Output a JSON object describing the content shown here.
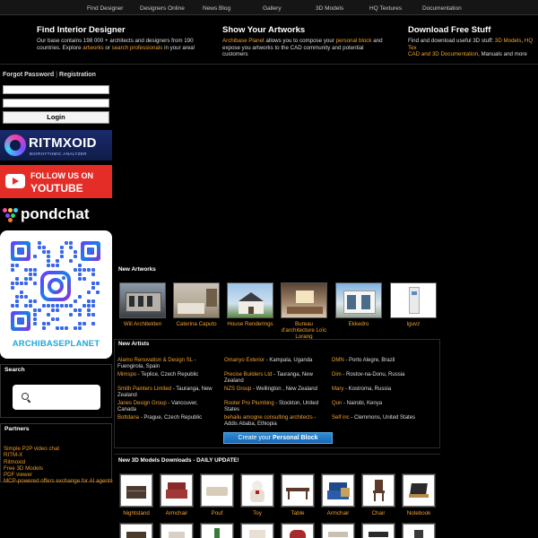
{
  "nav": [
    "Find Designer",
    "Designers Online",
    "News Blog",
    "Gallery",
    "3D Models",
    "HQ Textures",
    "Documentation"
  ],
  "promo": [
    {
      "title": "Find Interior Designer",
      "t1": "Our base contains 198 000 + architects and designers from 190 countries. Explore ",
      "l1": "artworks",
      "t2": " or ",
      "l2": "search professionals",
      "t3": " in your area!"
    },
    {
      "title": "Show Your Artworks",
      "l1": "Archibase Planet",
      "t1": " allows you to compose your ",
      "l2": "personal block",
      "t2": " and expose you artworks to the CAD community and potential customers"
    },
    {
      "title": "Download Free Stuff",
      "t1": "Find and download useful 3D stuff: ",
      "l1": "3D Models",
      "t2": ", ",
      "l2": "HQ Tex",
      "l3": "CAD and 3D Documentation",
      "t3": ", Manuals and more"
    }
  ],
  "auth": {
    "forgot": "Forgot Password",
    "sep": "|",
    "register": "Registration",
    "login": "Login"
  },
  "ads": {
    "ritm_title": "RITMXOID",
    "ritm_sub": "BIORHYTHMIC ANALYZER",
    "yt_line1": "FOLLOW US ON",
    "yt_line2": "YOUTUBE",
    "pond": "pondchat",
    "qr_brand": "ARCHIBASEPLANET"
  },
  "search": {
    "title": "Search",
    "placeholder": ""
  },
  "partners": {
    "title": "Partners",
    "items": [
      "Simple P2P video chat",
      "RITM-X",
      "Ritmoxid",
      "Free 3D Models",
      "PDF viewer",
      "MCP-powered offers exchange for AI agents"
    ]
  },
  "sections": {
    "artworks": "New Artworks",
    "artists": "New Artists",
    "models": "New 3D Models Downloads - DAILY UPDATE!"
  },
  "artworks": [
    "Wiil Architekten",
    "Caterina Caputo",
    "House Renderings",
    "Bureau d'architecture Loïc Lorang",
    "Ekkedro",
    "lguvz"
  ],
  "artists": [
    {
      "name": "Alamo Renovation & Design SL",
      "loc": " - Fuengirola, Spain"
    },
    {
      "name": "Omanyo Exterior",
      "loc": " - Kampala, Uganda"
    },
    {
      "name": "DMN",
      "loc": " - Porto Alegre, Brazil"
    },
    {
      "name": "Mimspo",
      "loc": " - Teplice, Czech Republic"
    },
    {
      "name": "Precise Builders Ltd",
      "loc": " - Tauranga, New Zealand"
    },
    {
      "name": "Dim",
      "loc": " - Rostov-na-Donu, Russia"
    },
    {
      "name": "Smith Painters Limited",
      "loc": " - Tauranga, New Zealand"
    },
    {
      "name": "NZS Group",
      "loc": " - Wellington , New Zealand"
    },
    {
      "name": "Mary",
      "loc": " - Kostroma, Russia"
    },
    {
      "name": "Janes Design Group",
      "loc": " - Vancouver, Canada"
    },
    {
      "name": "Rooter Pro Plumbing",
      "loc": " - Stockton, United States"
    },
    {
      "name": "Qun",
      "loc": " - Nairobi, Kenya"
    },
    {
      "name": "Bottdana",
      "loc": " - Prague, Czech Republic"
    },
    {
      "name": "behailu amogne consulting architects",
      "loc": " - Addis Ababa, Ethiopia"
    },
    {
      "name": "Self inc",
      "loc": " - Clemmons, United States"
    }
  ],
  "personal_block": {
    "pre": "Create your ",
    "strong": "Personal Block"
  },
  "models": [
    "Nightstand",
    "Armchair",
    "Pouf",
    "Toy",
    "Table",
    "Armchair",
    "Chair",
    "Notebook"
  ]
}
